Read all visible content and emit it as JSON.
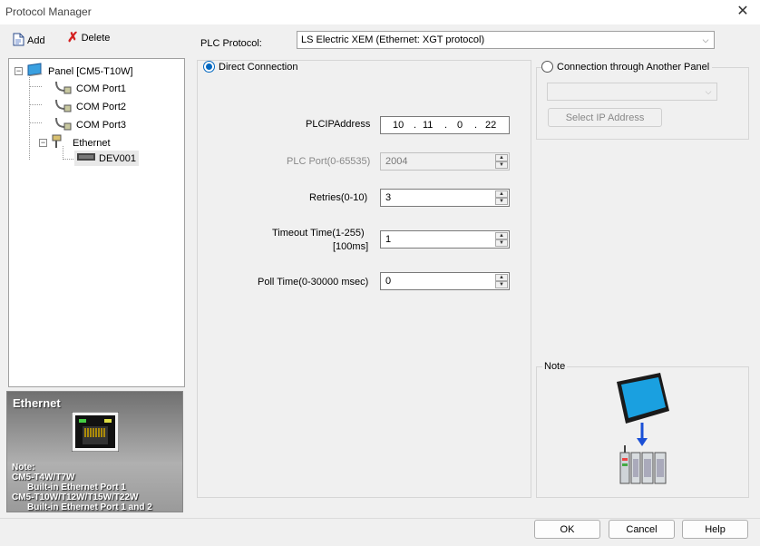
{
  "window": {
    "title": "Protocol Manager",
    "close": "✕"
  },
  "toolbar": {
    "add_label": "Add",
    "delete_label": "Delete"
  },
  "tree": {
    "panel": "Panel [CM5-T10W]",
    "com1": "COM Port1",
    "com2": "COM Port2",
    "com3": "COM Port3",
    "ethernet": "Ethernet",
    "device": "DEV001"
  },
  "info": {
    "heading": "Ethernet",
    "note_label": "Note:",
    "line1": "CM5-T4W/T7W",
    "line2": "Built-in Ethernet Port 1",
    "line3": "CM5-T10W/T12W/T15W/T22W",
    "line4": "Built-in Ethernet Port 1 and 2"
  },
  "protocol": {
    "label": "PLC Protocol:",
    "value": "LS Electric XEM (Ethernet: XGT protocol)"
  },
  "direct": {
    "label": "Direct Connection",
    "selected": true
  },
  "another": {
    "label": "Connection through Another Panel",
    "selected": false,
    "combo_value": "",
    "select_ip_label": "Select IP Address"
  },
  "fields": {
    "ip_label": "PLCIPAddress",
    "ip": [
      "10",
      "11",
      "0",
      "22"
    ],
    "port_label": "PLC Port(0-65535)",
    "port": "2004",
    "retries_label": "Retries(0-10)",
    "retries": "3",
    "timeout_label1": "Timeout Time(1-255)",
    "timeout_label2": "[100ms]",
    "timeout": "1",
    "poll_label": "Poll Time(0-30000 msec)",
    "poll": "0"
  },
  "note": {
    "label": "Note"
  },
  "buttons": {
    "ok": "OK",
    "cancel": "Cancel",
    "help": "Help"
  },
  "colors": {
    "accent": "#0067c0",
    "delete_x": "#d42020",
    "arrow": "#1a4fd6"
  }
}
